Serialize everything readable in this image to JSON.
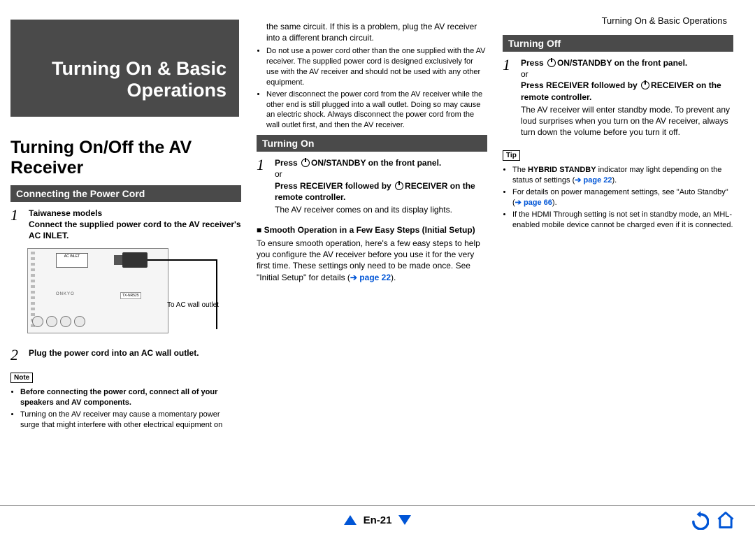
{
  "header": {
    "path": "Turning On & Basic Operations"
  },
  "chapterTitle": "Turning On & Basic Operations",
  "h1": "Turning On/Off the AV Receiver",
  "col1": {
    "section": "Connecting the Power Cord",
    "step1_sub": "Taiwanese models",
    "step1_body": "Connect the supplied power cord to the AV receiver's AC INLET.",
    "diagram_label": "To AC wall outlet",
    "diagram_acinlet": "AC INLET",
    "step2": "Plug the power cord into an AC wall outlet.",
    "noteLabel": "Note",
    "note_b1_bold": "Before connecting the power cord, connect all of your speakers and AV components.",
    "note_b2": "Turning on the AV receiver may cause a momentary power surge that might interfere with other electrical equipment on"
  },
  "col2": {
    "cont": "the same circuit. If this is a problem, plug the AV receiver into a different branch circuit.",
    "b1": "Do not use a power cord other than the one supplied with the AV receiver. The supplied power cord is designed exclusively for use with the AV receiver and should not be used with any other equipment.",
    "b2": "Never disconnect the power cord from the AV receiver while the other end is still plugged into a wall outlet. Doing so may cause an electric shock. Always disconnect the power cord from the wall outlet first, and then the AV receiver.",
    "section": "Turning On",
    "step1a_prefix": "Press ",
    "step1a_suffix": "ON/STANDBY on the front panel.",
    "step1_or": "or",
    "step1b_prefix": "Press RECEIVER followed by ",
    "step1b_suffix": "RECEIVER on the remote controller.",
    "step1_result": "The AV receiver comes on and its display lights.",
    "sub_h": "Smooth Operation in a Few Easy Steps (Initial Setup)",
    "sub_body_pre": "To ensure smooth operation, here's a few easy steps to help you configure the AV receiver before you use it for the very first time. These settings only need to be made once. See \"Initial Setup\" for details (",
    "sub_link": "➔ page 22",
    "sub_body_post": ")."
  },
  "col3": {
    "section": "Turning Off",
    "step1a_prefix": "Press ",
    "step1a_suffix": "ON/STANDBY on the front panel.",
    "step1_or": "or",
    "step1b_prefix": "Press RECEIVER followed by ",
    "step1b_suffix": "RECEIVER on the remote controller.",
    "step1_result": "The AV receiver will enter standby mode. To prevent any loud surprises when you turn on the AV receiver, always turn down the volume before you turn it off.",
    "tipLabel": "Tip",
    "tip1_pre": "The ",
    "tip1_bold": "HYBRID STANDBY",
    "tip1_mid": " indicator may light depending on the status of settings (",
    "tip1_link": "➔ page 22",
    "tip1_post": ").",
    "tip2_pre": "For details on power management settings, see \"Auto Standby\" (",
    "tip2_link": "➔ page 66",
    "tip2_post": ").",
    "tip3": "If the HDMI Through setting is not set in standby mode, an MHL-enabled mobile device cannot be charged even if it is connected."
  },
  "footer": {
    "page": "En-21"
  }
}
